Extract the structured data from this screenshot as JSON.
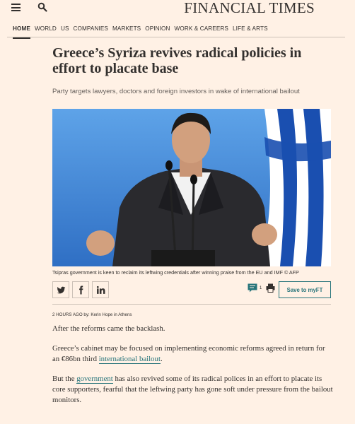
{
  "header": {
    "masthead": "FINANCIAL TIMES",
    "menu_icon": "hamburger-menu-icon",
    "search_icon": "search-icon"
  },
  "nav": {
    "items": [
      "HOME",
      "WORLD",
      "US",
      "COMPANIES",
      "MARKETS",
      "OPINION",
      "WORK & CAREERS",
      "LIFE & ARTS"
    ],
    "active": "HOME"
  },
  "article": {
    "headline": "Greece’s Syriza revives radical policies in effort to placate base",
    "standfirst": "Party targets lawyers, doctors and foreign investors in wake of international bailout",
    "caption": "Tsipras government is keen to reclaim its leftwing credentials after winning praise from the EU and IMF © AFP",
    "byline_time": "2 HOURS AGO",
    "byline_by": "by:",
    "byline_author": "Kerin Hope in Athens",
    "p1": "After the reforms came the backlash.",
    "p2_a": "Greece’s cabinet may be focused on implementing economic reforms agreed in return for an €86bn third ",
    "p2_link": "international bailout",
    "p2_b": ".",
    "p3_a": "But the ",
    "p3_link": "government",
    "p3_b": " has also revived some of its radical polices in an effort to placate its core supporters, fearful that the leftwing party has gone soft under pressure from the bailout monitors."
  },
  "share": {
    "twitter_icon": "twitter-icon",
    "facebook_icon": "facebook-icon",
    "linkedin_icon": "linkedin-icon",
    "comment_icon": "comment-icon",
    "comment_count": "1",
    "print_icon": "print-icon",
    "save_label": "Save to myFT"
  },
  "colors": {
    "background": "#fff1e5",
    "text": "#33302e",
    "accent": "#26747a",
    "rule": "#ccc1b7"
  }
}
